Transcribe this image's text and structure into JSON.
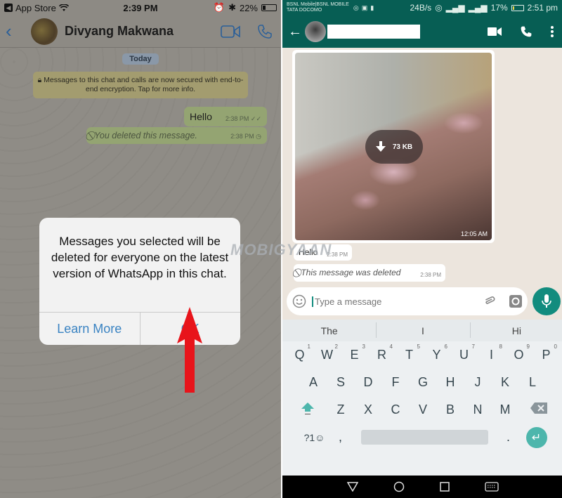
{
  "ios": {
    "statusbar": {
      "back_app": "App Store",
      "time": "2:39 PM",
      "battery": "22%"
    },
    "header": {
      "contact_name": "Divyang Makwana"
    },
    "chat": {
      "date_chip": "Today",
      "encryption_notice": "Messages to this chat and calls are now secured with end-to-end encryption. Tap for more info.",
      "messages": [
        {
          "text": "Hello",
          "time": "2:38 PM",
          "status": "read"
        },
        {
          "text": "You deleted this message.",
          "time": "2:38 PM",
          "status": "pending"
        }
      ]
    },
    "alert": {
      "message": "Messages you selected will be deleted for everyone on the latest version of WhatsApp in this chat.",
      "learn_more": "Learn More",
      "ok": "OK"
    },
    "annotation_color": "#e8141b"
  },
  "watermark": "MOBIGYAAN",
  "android": {
    "statusbar": {
      "carrier_1": "BSNL Mobile|BSNL MOBILE",
      "carrier_2": "TATA DOCOMO",
      "speed": "24B/s",
      "battery": "17%",
      "time": "2:51 pm"
    },
    "chat": {
      "image": {
        "size": "73 KB",
        "time": "12:05 AM"
      },
      "messages": [
        {
          "text": "Hello",
          "time": "2:38 PM"
        },
        {
          "text": "This message was deleted",
          "time": "2:38 PM"
        }
      ]
    },
    "composer": {
      "placeholder": "Type a message"
    },
    "keyboard": {
      "suggestions": [
        "The",
        "I",
        "Hi"
      ],
      "row1": [
        "Q",
        "W",
        "E",
        "R",
        "T",
        "Y",
        "U",
        "I",
        "O",
        "P"
      ],
      "row1_hints": [
        "1",
        "2",
        "3",
        "4",
        "5",
        "6",
        "7",
        "8",
        "9",
        "0"
      ],
      "row2": [
        "A",
        "S",
        "D",
        "F",
        "G",
        "H",
        "J",
        "K",
        "L"
      ],
      "row3": [
        "Z",
        "X",
        "C",
        "V",
        "B",
        "N",
        "M"
      ],
      "symbols_key": "?1☺",
      "comma": ",",
      "period": "."
    },
    "colors": {
      "primary": "#075e54",
      "accent": "#128c7e",
      "keyboard_accent": "#4db6ac"
    }
  }
}
